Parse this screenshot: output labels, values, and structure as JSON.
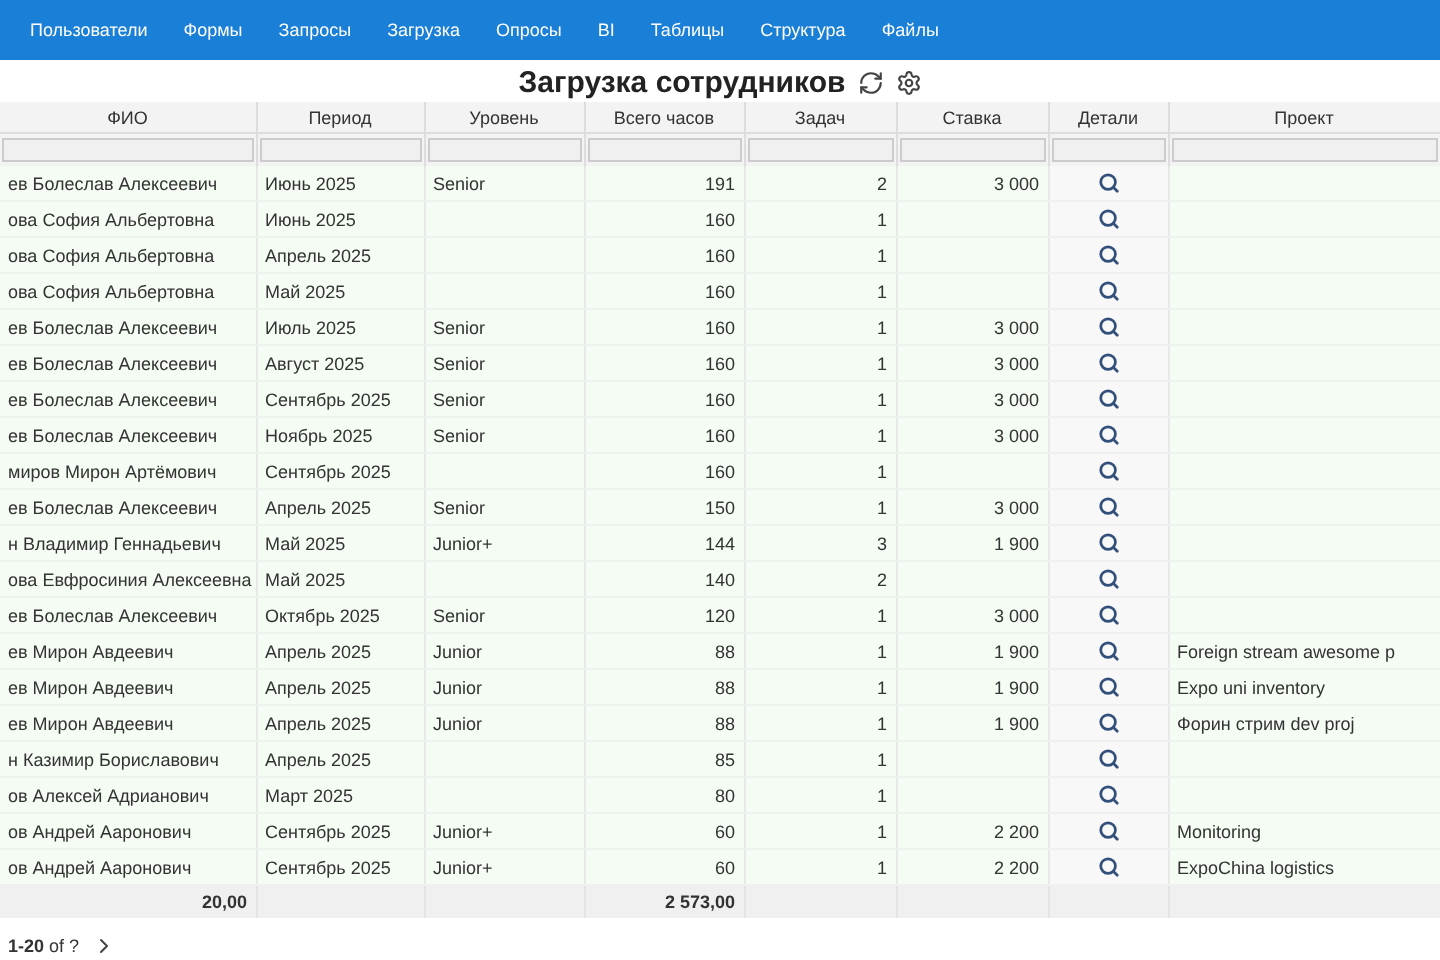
{
  "nav": {
    "items": [
      {
        "label": "Пользователи"
      },
      {
        "label": "Формы"
      },
      {
        "label": "Запросы"
      },
      {
        "label": "Загрузка"
      },
      {
        "label": "Опросы"
      },
      {
        "label": "BI"
      },
      {
        "label": "Таблицы"
      },
      {
        "label": "Структура"
      },
      {
        "label": "Файлы"
      }
    ]
  },
  "title": "Загрузка сотрудников",
  "table": {
    "columns": [
      "ФИО",
      "Период",
      "Уровень",
      "Всего часов",
      "Задач",
      "Ставка",
      "Детали",
      "Проект"
    ],
    "rows": [
      {
        "fio": "ев Болеслав Алексеевич",
        "period": "Июнь 2025",
        "level": "Senior",
        "hours": "191",
        "tasks": "2",
        "rate": "3 000"
      },
      {
        "fio": "ова София Альбертовна",
        "period": "Июнь 2025",
        "hours": "160",
        "tasks": "1"
      },
      {
        "fio": "ова София Альбертовна",
        "period": "Апрель 2025",
        "hours": "160",
        "tasks": "1"
      },
      {
        "fio": "ова София Альбертовна",
        "period": "Май 2025",
        "hours": "160",
        "tasks": "1"
      },
      {
        "fio": "ев Болеслав Алексеевич",
        "period": "Июль 2025",
        "level": "Senior",
        "hours": "160",
        "tasks": "1",
        "rate": "3 000"
      },
      {
        "fio": "ев Болеслав Алексеевич",
        "period": "Август 2025",
        "level": "Senior",
        "hours": "160",
        "tasks": "1",
        "rate": "3 000"
      },
      {
        "fio": "ев Болеслав Алексеевич",
        "period": "Сентябрь 2025",
        "level": "Senior",
        "hours": "160",
        "tasks": "1",
        "rate": "3 000"
      },
      {
        "fio": "ев Болеслав Алексеевич",
        "period": "Ноябрь 2025",
        "level": "Senior",
        "hours": "160",
        "tasks": "1",
        "rate": "3 000"
      },
      {
        "fio": "миров Мирон Артёмович",
        "period": "Сентябрь 2025",
        "hours": "160",
        "tasks": "1"
      },
      {
        "fio": "ев Болеслав Алексеевич",
        "period": "Апрель 2025",
        "level": "Senior",
        "hours": "150",
        "tasks": "1",
        "rate": "3 000"
      },
      {
        "fio": "н Владимир Геннадьевич",
        "period": "Май 2025",
        "level": "Junior+",
        "hours": "144",
        "tasks": "3",
        "rate": "1 900"
      },
      {
        "fio": "ова Евфросиния Алексеевна",
        "period": "Май 2025",
        "hours": "140",
        "tasks": "2"
      },
      {
        "fio": "ев Болеслав Алексеевич",
        "period": "Октябрь 2025",
        "level": "Senior",
        "hours": "120",
        "tasks": "1",
        "rate": "3 000"
      },
      {
        "fio": "ев Мирон Авдеевич",
        "period": "Апрель 2025",
        "level": "Junior",
        "hours": "88",
        "tasks": "1",
        "rate": "1 900",
        "project": "Foreign stream awesome p"
      },
      {
        "fio": "ев Мирон Авдеевич",
        "period": "Апрель 2025",
        "level": "Junior",
        "hours": "88",
        "tasks": "1",
        "rate": "1 900",
        "project": "Expo uni inventory"
      },
      {
        "fio": "ев Мирон Авдеевич",
        "period": "Апрель 2025",
        "level": "Junior",
        "hours": "88",
        "tasks": "1",
        "rate": "1 900",
        "project": "Форин стрим dev proj"
      },
      {
        "fio": "н Казимир Бориславович",
        "period": "Апрель 2025",
        "hours": "85",
        "tasks": "1"
      },
      {
        "fio": "ов Алексей Адрианович",
        "period": "Март 2025",
        "hours": "80",
        "tasks": "1"
      },
      {
        "fio": "ов Андрей Ааронович",
        "period": "Сентябрь 2025",
        "level": "Junior+",
        "hours": "60",
        "tasks": "1",
        "rate": "2 200",
        "project": "Monitoring"
      },
      {
        "fio": "ов Андрей Ааронович",
        "period": "Сентябрь 2025",
        "level": "Junior+",
        "hours": "60",
        "tasks": "1",
        "rate": "2 200",
        "project": "ExpoChina logistics"
      }
    ],
    "totals": {
      "fio": "20,00",
      "hours": "2 573,00"
    }
  },
  "pagination": {
    "range": "**1-20** of ?"
  }
}
